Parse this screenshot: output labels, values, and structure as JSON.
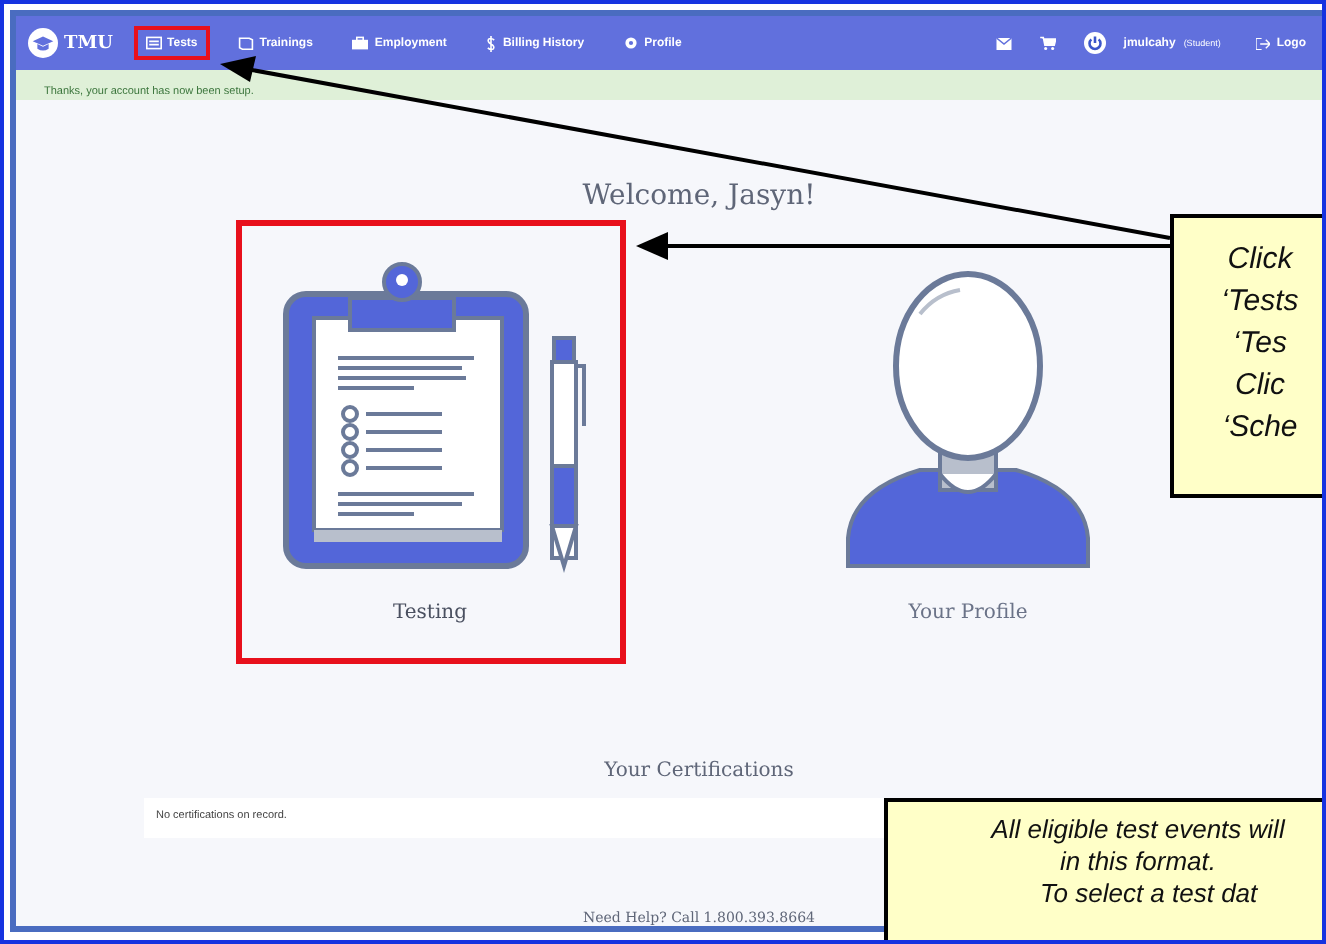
{
  "navbar": {
    "logo": "TMU",
    "items": [
      {
        "label": "Tests",
        "kind": "list",
        "highlighted": true
      },
      {
        "label": "Trainings",
        "kind": "book",
        "highlighted": false
      },
      {
        "label": "Employment",
        "kind": "briefcase",
        "highlighted": false
      },
      {
        "label": "Billing History",
        "kind": "dollar",
        "highlighted": false
      },
      {
        "label": "Profile",
        "kind": "gear",
        "highlighted": false
      }
    ],
    "user": {
      "name": "jmulcahy",
      "role": "(Student)"
    },
    "logout": "Logo"
  },
  "alert": "Thanks, your account has now been setup.",
  "welcome": "Welcome, Jasyn!",
  "cards": [
    {
      "kind": "testing",
      "label": "Testing",
      "highlighted": true
    },
    {
      "kind": "profile",
      "label": "Your Profile",
      "highlighted": false
    }
  ],
  "certifications": {
    "title": "Your Certifications",
    "empty": "No certifications on record."
  },
  "help": "Need Help? Call 1.800.393.8664",
  "callouts": [
    {
      "kind": "top",
      "lines": [
        "Click",
        "‘Tests",
        "‘Tes",
        "Clic",
        "‘Sche"
      ]
    },
    {
      "kind": "bottom",
      "lines": [
        "All eligible test events will",
        "in this format.",
        "To select a test dat"
      ]
    }
  ]
}
